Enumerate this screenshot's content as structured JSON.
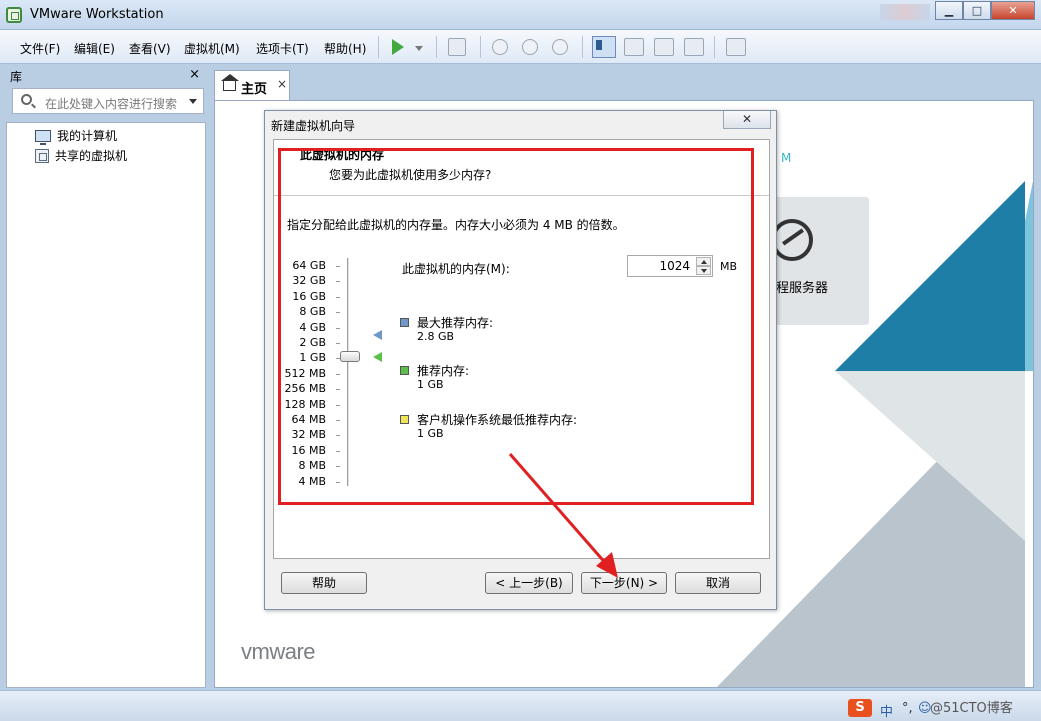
{
  "window": {
    "title": "VMware Workstation"
  },
  "menu": [
    "文件(F)",
    "编辑(E)",
    "查看(V)",
    "虚拟机(M)",
    "选项卡(T)",
    "帮助(H)"
  ],
  "library": {
    "title": "库",
    "close": "×",
    "search_placeholder": "在此处键入内容进行搜索",
    "items": [
      "我的计算机",
      "共享的虚拟机"
    ]
  },
  "tab": {
    "label": "主页",
    "close": "×"
  },
  "home": {
    "remote_server_label": "远程服务器",
    "teal_fragment": "M",
    "logo": "vmware"
  },
  "dialog": {
    "title": "新建虚拟机向导",
    "close": "✕",
    "heading": "此虚拟机的内存",
    "subheading": "您要为此虚拟机使用多少内存?",
    "instruction": "指定分配给此虚拟机的内存量。内存大小必须为 4 MB 的倍数。",
    "memory_label": "此虚拟机的内存(M):",
    "memory_value": "1024",
    "memory_unit": "MB",
    "scale": [
      "64 GB",
      "32 GB",
      "16 GB",
      "8 GB",
      "4 GB",
      "2 GB",
      "1 GB",
      "512 MB",
      "256 MB",
      "128 MB",
      "64 MB",
      "32 MB",
      "16 MB",
      "8 MB",
      "4 MB"
    ],
    "slider_selected": "1 GB",
    "legend": [
      {
        "title": "最大推荐内存:",
        "value": "2.8 GB",
        "color": "#6f97c7"
      },
      {
        "title": "推荐内存:",
        "value": "1 GB",
        "color": "#5cbf4a"
      },
      {
        "title": "客户机操作系统最低推荐内存:",
        "value": "1 GB",
        "color": "#f2e25a"
      }
    ],
    "buttons": {
      "help": "帮助",
      "back": "< 上一步(B)",
      "next": "下一步(N) >",
      "cancel": "取消"
    }
  },
  "taskbar": {
    "ime_icon": "S",
    "ime_lang": "中",
    "watermark": "@51CTO博客"
  },
  "colors": {
    "annotation_red": "#e02020",
    "accent_teal": "#1f7ea6"
  }
}
